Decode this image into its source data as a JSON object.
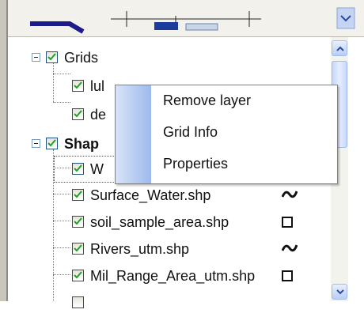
{
  "preview": {
    "icon": "map-preview-thumbnail"
  },
  "tree": {
    "groups": [
      {
        "label": "Grids",
        "checked": true,
        "layers": [
          {
            "label": "lul",
            "checked": true
          },
          {
            "label": "de",
            "checked": true
          }
        ]
      },
      {
        "label": "Shap",
        "checked": true,
        "layers": [
          {
            "label": "W",
            "checked": true
          },
          {
            "label": "Surface_Water.shp",
            "checked": true,
            "symbol": "line-wave-icon"
          },
          {
            "label": "soil_sample_area.shp",
            "checked": true,
            "symbol": "polygon-box-icon"
          },
          {
            "label": "Rivers_utm.shp",
            "checked": true,
            "symbol": "line-wave-icon"
          },
          {
            "label": "Mil_Range_Area_utm.shp",
            "checked": true,
            "symbol": "polygon-box-icon"
          }
        ]
      }
    ]
  },
  "context_menu": {
    "items": [
      "Remove layer",
      "Grid Info",
      "Properties"
    ]
  },
  "scrollbar": {
    "up_icon": "chevron-up-icon",
    "down_icon": "chevron-down-icon"
  },
  "colors": {
    "menu_gutter": "#9db9ec",
    "scroll_accent": "#b9cef5",
    "tree_line": "#7a7a7a"
  }
}
